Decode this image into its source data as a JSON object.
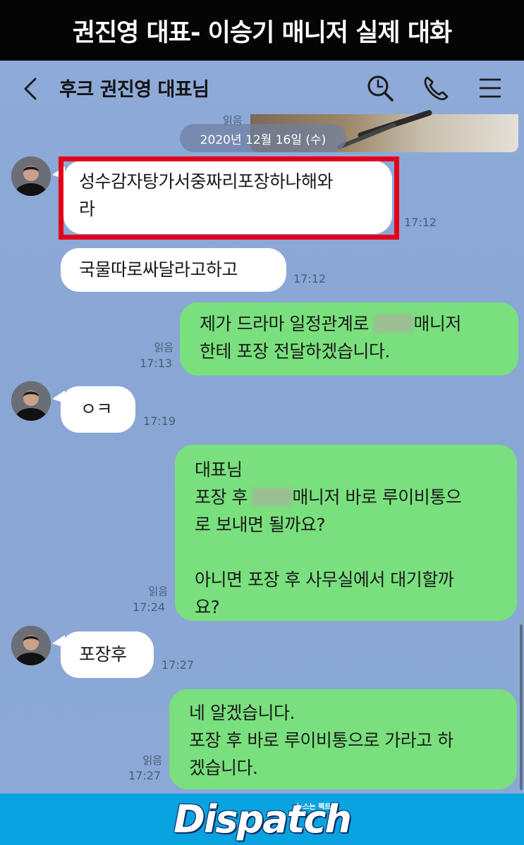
{
  "banner": {
    "title": "권진영 대표- 이승기 매니저 실제 대화"
  },
  "header": {
    "back_icon": "chevron-left-icon",
    "title": "후크 권진영 대표님",
    "icons": [
      "search-icon",
      "phone-icon",
      "menu-icon"
    ]
  },
  "date_divider": {
    "read_label": "읽음",
    "date": "2020년 12월 16일 (수)"
  },
  "messages": [
    {
      "side": "left",
      "lines": [
        "성수감자탕가서중짜리포장하나해와",
        "라"
      ],
      "time": "17:12",
      "highlighted": true
    },
    {
      "side": "left",
      "lines": [
        "국물따로싸달라고하고"
      ],
      "time": "17:12"
    },
    {
      "side": "right",
      "lines": [
        "제가 드라마 일정관계로",
        "매니저",
        "한테 포장 전달하겠습니다."
      ],
      "read": "읽음",
      "time": "17:13"
    },
    {
      "side": "left",
      "lines": [
        "ㅇㅋ"
      ],
      "time": "17:19"
    },
    {
      "side": "right",
      "lines": [
        "대표님",
        "포장 후",
        "매니저 바로 루이비통으",
        "로 보내면 될까요?",
        "아니면 포장 후 사무실에서 대기할까",
        "요?"
      ],
      "read": "읽음",
      "time": "17:24"
    },
    {
      "side": "left",
      "lines": [
        "포장후"
      ],
      "time": "17:27"
    },
    {
      "side": "right",
      "lines": [
        "네 알겠습니다.",
        "포장 후 바로 루이비통으로 가라고 하",
        "겠습니다."
      ],
      "read": "읽음",
      "time": "17:27"
    }
  ],
  "footer": {
    "logo": "Dispatch",
    "tagline": "뉴스는 팩트다"
  },
  "colors": {
    "chat_bg": "#8aa7d6",
    "my_bubble": "#79e07d",
    "their_bubble": "#ffffff",
    "highlight": "#e3001b",
    "footer": "#08a3e0"
  }
}
